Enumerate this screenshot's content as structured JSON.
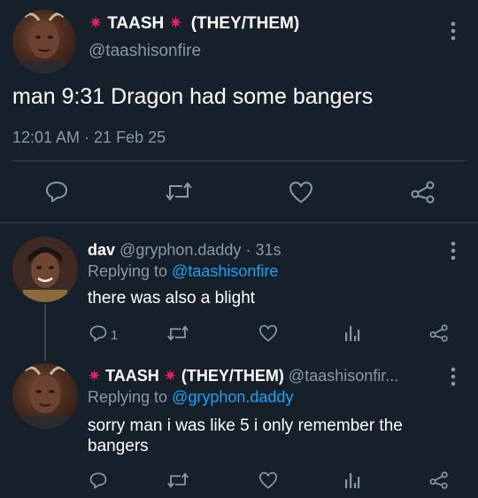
{
  "colors": {
    "background": "#15202b",
    "text": "#ffffff",
    "muted": "#8899a6",
    "link": "#1da1f2",
    "divider": "#38444d",
    "emoji_red": "#e0245e"
  },
  "main_tweet": {
    "display_name": "TAASH",
    "pronouns": "(THEY/THEM)",
    "name_emoji": "sparkle-burst-icon",
    "handle": "@taashisonfire",
    "text": "man 9:31 Dragon had some bangers",
    "timestamp": "12:01 AM · 21 Feb 25"
  },
  "reply_1": {
    "display_name": "dav",
    "handle": "@gryphon.daddy",
    "separator": "·",
    "time": "31s",
    "replying_prefix": "Replying to",
    "replying_handle": "@taashisonfire",
    "text": "there was also a blight",
    "reply_count": "1"
  },
  "reply_2": {
    "display_name": "TAASH",
    "pronouns": "(THEY/THEM)",
    "handle": "@taashisonfir...",
    "replying_prefix": "Replying to",
    "replying_handle": "@gryphon.daddy",
    "text_line_1": "sorry man i was like 5 i only remember the",
    "text_line_2": "bangers"
  }
}
